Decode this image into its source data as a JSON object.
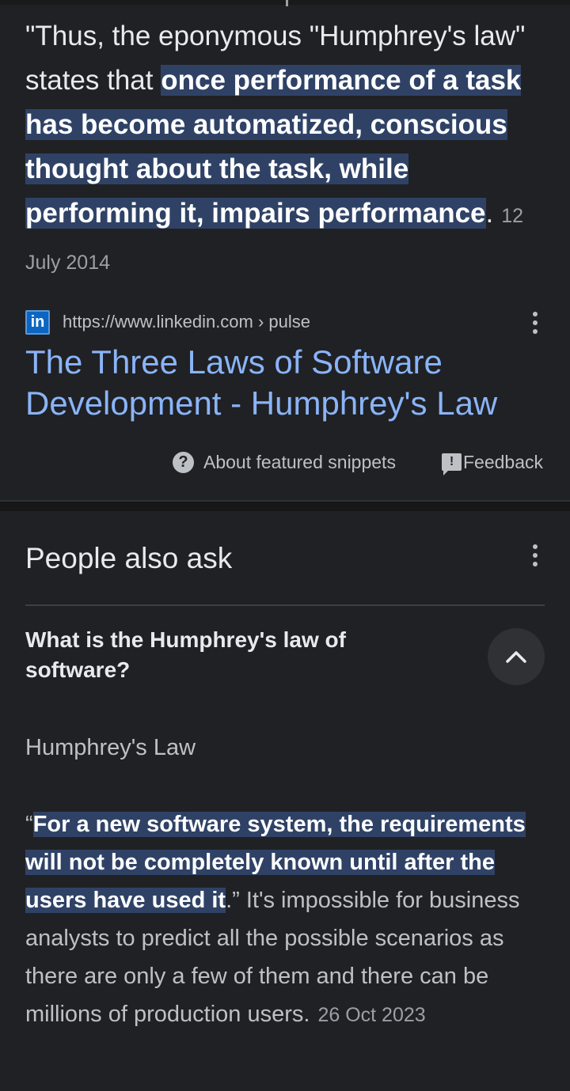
{
  "featured_snippet": {
    "text_before": "\"Thus, the eponymous \"Humphrey's law\" states that ",
    "highlight": "once performance of a task has become automatized, conscious thought about the task, while performing it, impairs performance",
    "text_after": ".",
    "date": "12 July 2014",
    "source": {
      "favicon_text": "in",
      "url": "https://www.linkedin.com › pulse",
      "title": "The Three Laws of Software Development - Humphrey's Law"
    },
    "footer": {
      "about_label": "About featured snippets",
      "feedback_label": "Feedback"
    }
  },
  "people_also_ask": {
    "title": "People also ask",
    "question": "What is the Humphrey's law of software?",
    "answer": {
      "source_title": "Humphrey's Law",
      "open_quote": "“",
      "highlight": "For a new software system, the requirements will not be completely known until after the users have used it",
      "text_after": ".” It's impossible for business analysts to predict all the possible scenarios as there are only a few of them and there can be millions of production users.",
      "date": "26 Oct 2023"
    }
  },
  "icons": {
    "more": "more-vert-icon",
    "help": "help-circle-icon",
    "feedback": "feedback-icon",
    "collapse": "chevron-up-icon"
  },
  "colors": {
    "background": "#202124",
    "link": "#8ab4f8",
    "highlight": "#2f4266"
  }
}
